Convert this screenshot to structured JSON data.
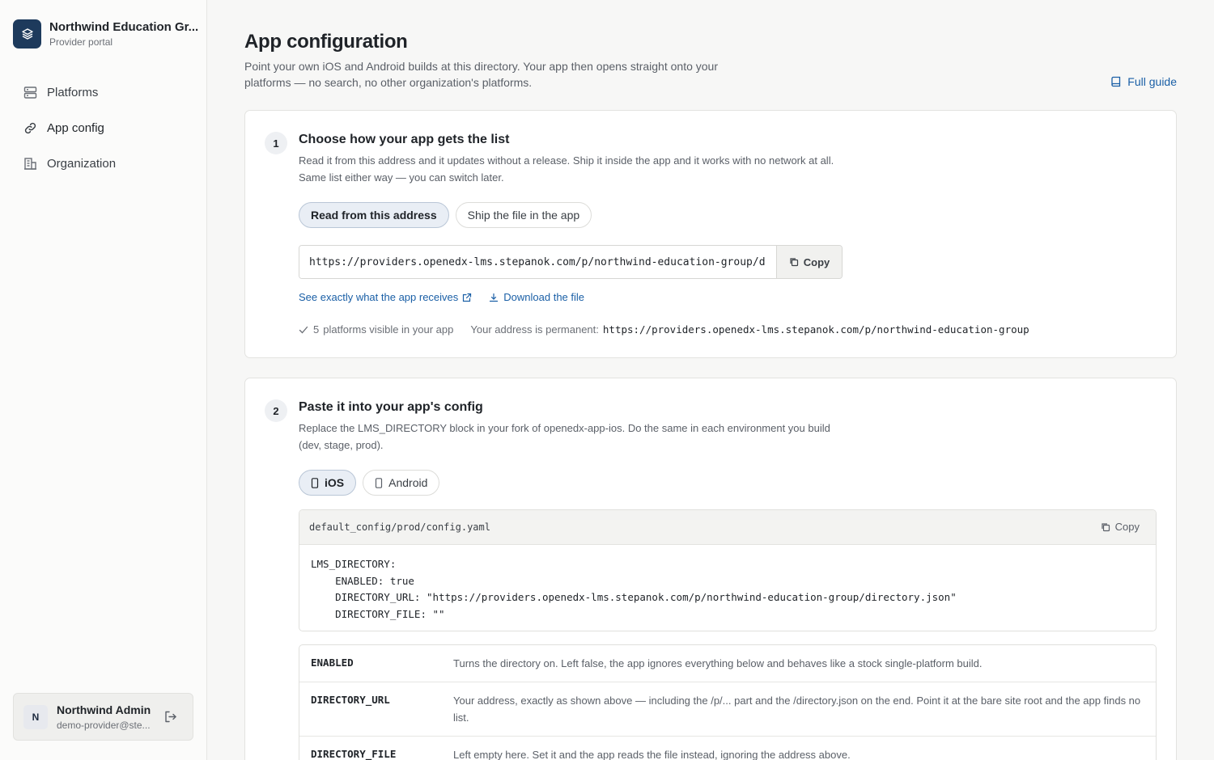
{
  "brand": {
    "name": "Northwind Education Gr...",
    "subtitle": "Provider portal"
  },
  "nav": [
    {
      "label": "Platforms",
      "icon": "server-icon"
    },
    {
      "label": "App config",
      "icon": "link-icon",
      "active": true
    },
    {
      "label": "Organization",
      "icon": "building-icon"
    }
  ],
  "user": {
    "initial": "N",
    "name": "Northwind Admin",
    "email": "demo-provider@ste..."
  },
  "page": {
    "title": "App configuration",
    "description": "Point your own iOS and Android builds at this directory. Your app then opens straight onto your platforms — no search, no other organization's platforms.",
    "guide_label": "Full guide"
  },
  "step1": {
    "number": "1",
    "title": "Choose how your app gets the list",
    "description": "Read it from this address and it updates without a release. Ship it inside the app and it works with no network at all. Same list either way — you can switch later.",
    "options": [
      "Read from this address",
      "Ship the file in the app"
    ],
    "selected_option": "Read from this address",
    "url_value": "https://providers.openedx-lms.stepanok.com/p/northwind-education-group/d",
    "copy_label": "Copy",
    "preview_link": "See exactly what the app receives",
    "download_link": "Download the file",
    "visible_count": "5",
    "visible_text": "platforms visible in your app",
    "address_label": "Your address is permanent:",
    "address_value": "https://providers.openedx-lms.stepanok.com/p/northwind-education-group"
  },
  "step2": {
    "number": "2",
    "title": "Paste it into your app's config",
    "description": "Replace the LMS_DIRECTORY block in your fork of openedx-app-ios. Do the same in each environment you build (dev, stage, prod).",
    "tabs": [
      "iOS",
      "Android"
    ],
    "selected_tab": "iOS",
    "file_path": "default_config/prod/config.yaml",
    "copy_label": "Copy",
    "code": "LMS_DIRECTORY:\n    ENABLED: true\n    DIRECTORY_URL: \"https://providers.openedx-lms.stepanok.com/p/northwind-education-group/directory.json\"\n    DIRECTORY_FILE: \"\"",
    "fields": [
      {
        "key": "ENABLED",
        "desc": "Turns the directory on. Left false, the app ignores everything below and behaves like a stock single-platform build."
      },
      {
        "key": "DIRECTORY_URL",
        "desc": "Your address, exactly as shown above — including the /p/... part and the /directory.json on the end. Point it at the bare site root and the app finds no list."
      },
      {
        "key": "DIRECTORY_FILE",
        "desc": "Left empty here. Set it and the app reads the file instead, ignoring the address above."
      }
    ]
  },
  "colors": {
    "accent": "#1a5fa6",
    "brand": "#1d3a5c",
    "selected_bg": "#e9eef5"
  }
}
